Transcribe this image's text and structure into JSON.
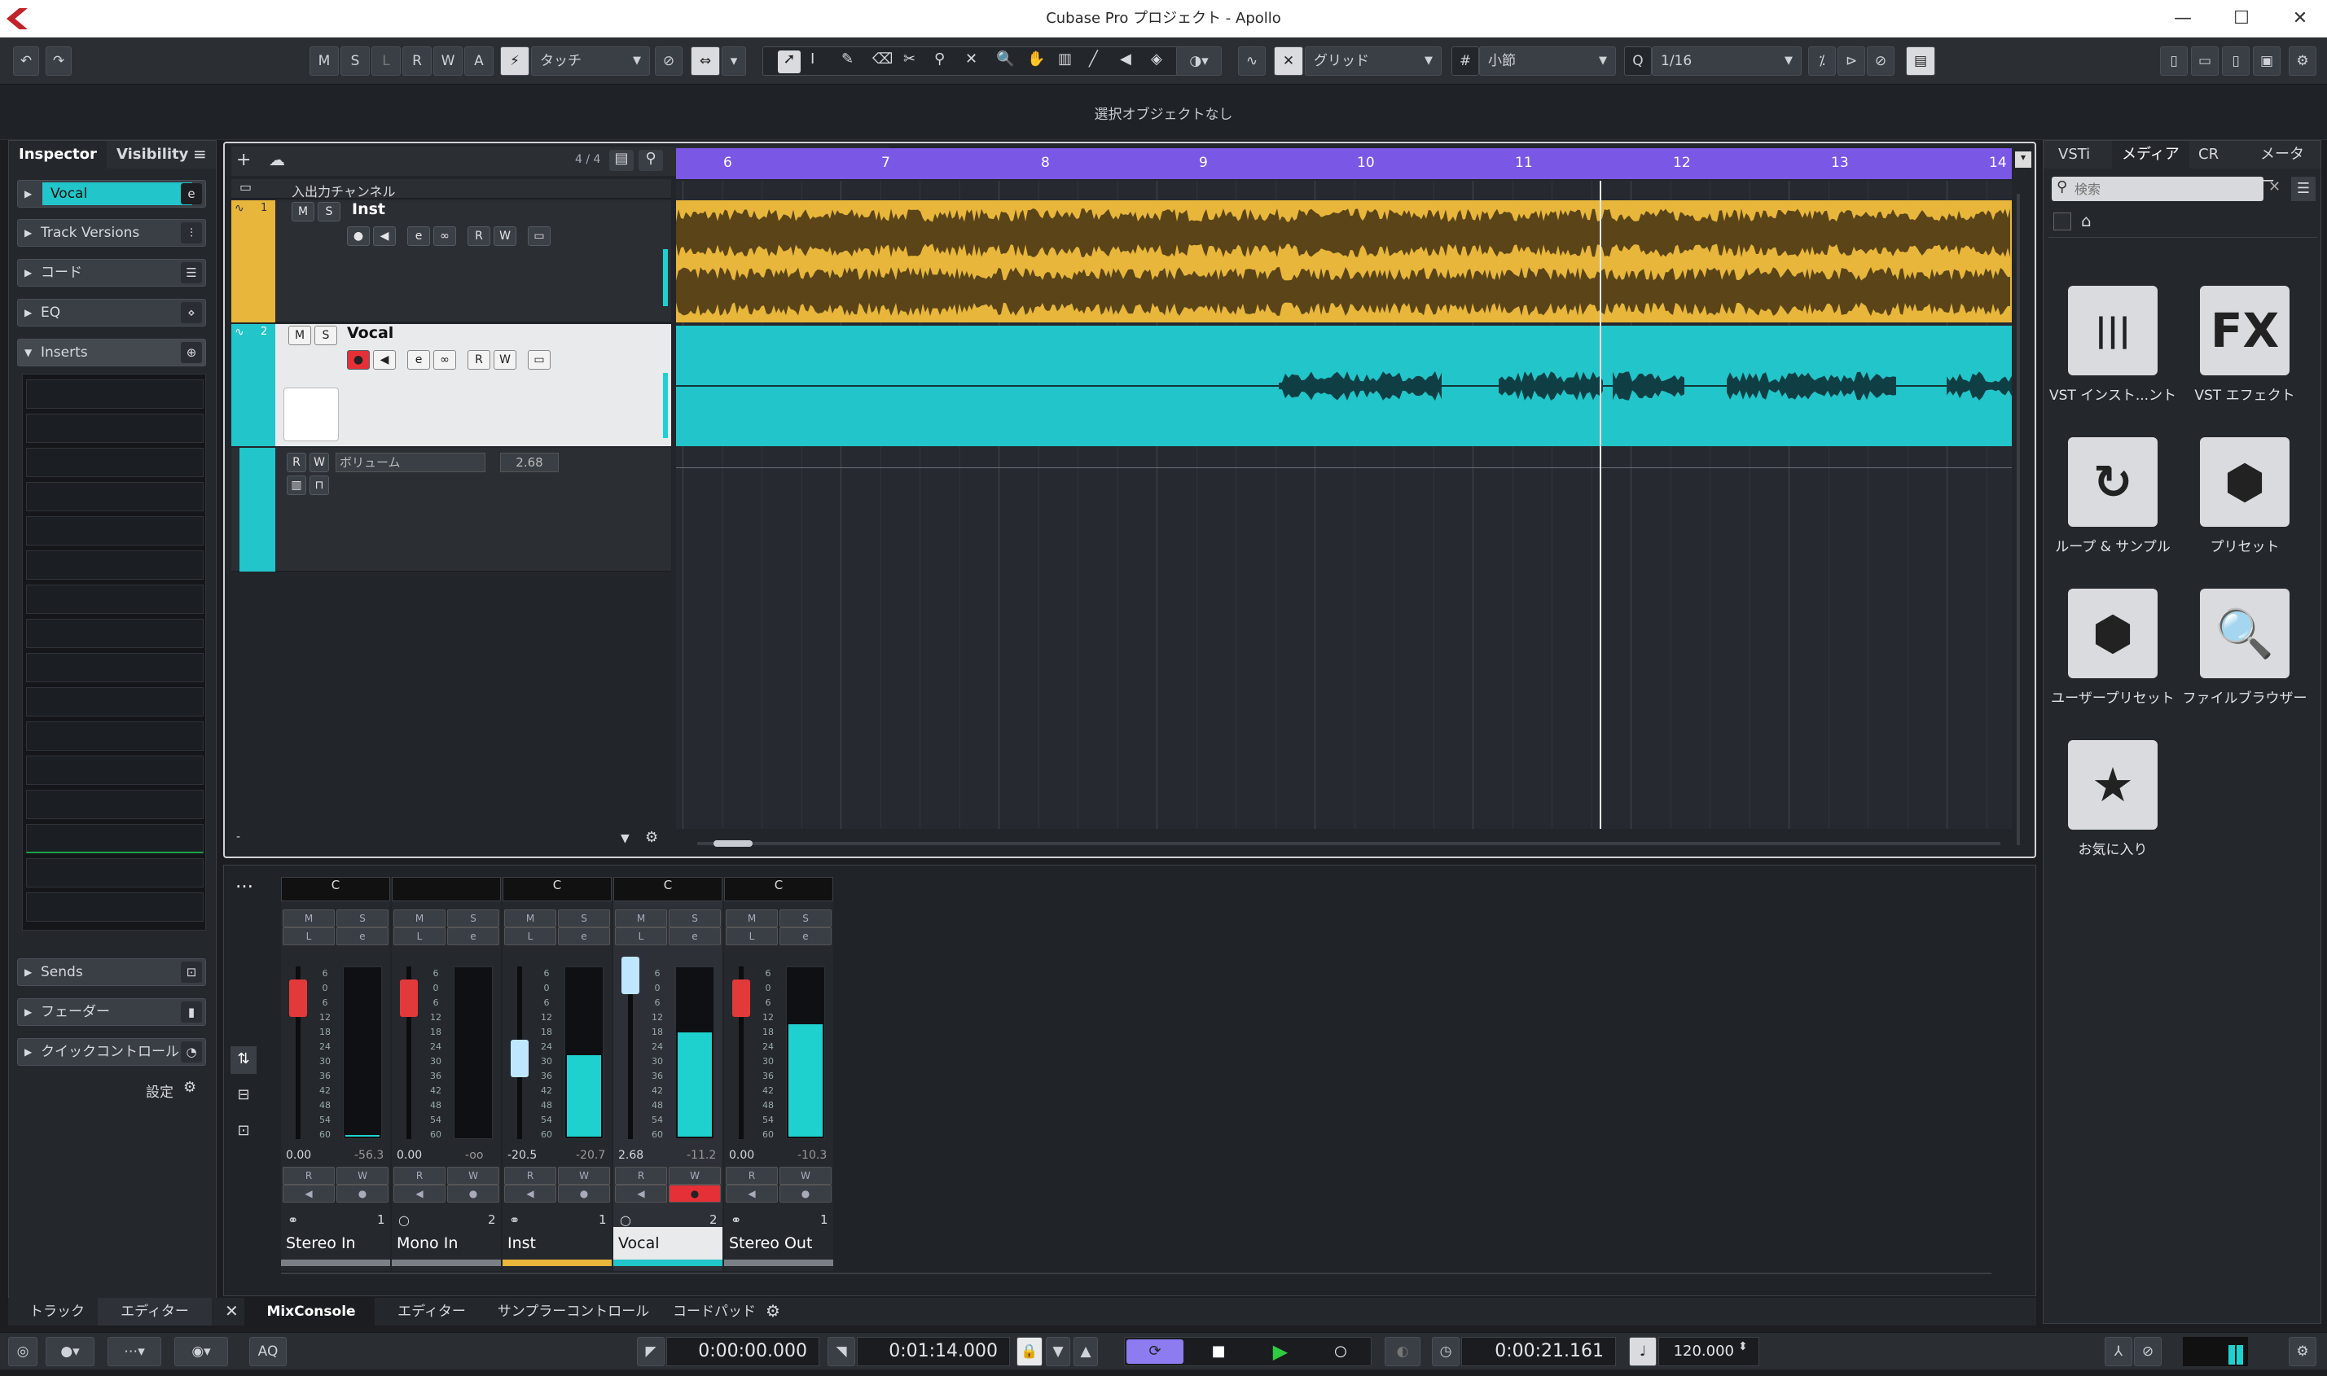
{
  "window": {
    "title": "Cubase Pro プロジェクト - Apollo"
  },
  "toolbar": {
    "msl": [
      "M",
      "S",
      "L",
      "R",
      "W",
      "A"
    ],
    "automation_mode": "タッチ",
    "snap_type": "グリッド",
    "grid_type": "小節",
    "quantize": "1/16"
  },
  "info_line": {
    "text": "選択オブジェクトなし"
  },
  "inspector": {
    "tab_inspector": "Inspector",
    "tab_visibility": "Visibility",
    "track_name": "Vocal",
    "sections": [
      "Track Versions",
      "コード",
      "EQ",
      "Inserts"
    ],
    "lower_sections": [
      "Sends",
      "フェーダー",
      "クイックコントロール"
    ],
    "settings_label": "設定"
  },
  "tracklist": {
    "count": "4 / 4",
    "io_channel": "入出力チャンネル",
    "tracks": [
      {
        "number": "1",
        "name": "Inst"
      },
      {
        "number": "2",
        "name": "Vocal"
      }
    ],
    "volume_label": "ボリューム",
    "volume_value": "2.68"
  },
  "ruler": {
    "bars": [
      "6",
      "7",
      "8",
      "9",
      "10",
      "11",
      "12",
      "13",
      "14"
    ]
  },
  "mixer": {
    "strips": [
      {
        "name": "Stereo In",
        "num": "1",
        "pan": "C",
        "fader": "0.00",
        "peak": "-56.3",
        "color": "#7b7f86"
      },
      {
        "name": "Mono In",
        "num": "2",
        "pan": "",
        "fader": "0.00",
        "peak": "-oo",
        "color": "#7b7f86"
      },
      {
        "name": "Inst",
        "num": "1",
        "pan": "C",
        "fader": "-20.5",
        "peak": "-20.7",
        "color": "#e8b63a"
      },
      {
        "name": "Vocal",
        "num": "2",
        "pan": "C",
        "fader": "2.68",
        "peak": "-11.2",
        "color": "#22c5c9"
      },
      {
        "name": "Stereo Out",
        "num": "1",
        "pan": "C",
        "fader": "0.00",
        "peak": "-10.3",
        "color": "#7b7f86"
      }
    ],
    "scale": [
      "6",
      "0",
      "6",
      "12",
      "18",
      "24",
      "30",
      "36",
      "42",
      "48",
      "54",
      "60"
    ]
  },
  "lower_tabs": {
    "left": [
      "トラック",
      "エディター"
    ],
    "right": [
      "MixConsole",
      "エディター",
      "サンプラーコントロール",
      "コードパッド"
    ]
  },
  "media": {
    "tabs": [
      "VSTi",
      "メディア",
      "CR",
      "メーター"
    ],
    "search_placeholder": "検索",
    "tiles": [
      {
        "label": "VST インスト...ント",
        "icon": "piano-keys-icon",
        "glyph": "|||"
      },
      {
        "label": "VST エフェクト",
        "icon": "fx-icon",
        "glyph": "FX"
      },
      {
        "label": "ループ & サンプル",
        "icon": "loop-icon",
        "glyph": "↻"
      },
      {
        "label": "プリセット",
        "icon": "preset-icon",
        "glyph": "⬢"
      },
      {
        "label": "ユーザープリセット",
        "icon": "user-preset-icon",
        "glyph": "⬢"
      },
      {
        "label": "ファイルブラウザー",
        "icon": "file-browser-icon",
        "glyph": "🔍"
      },
      {
        "label": "お気に入り",
        "icon": "star-icon",
        "glyph": "★"
      }
    ]
  },
  "transport": {
    "left_locator": "0:00:00.000",
    "right_locator": "0:01:14.000",
    "position": "0:00:21.161",
    "tempo": "120.000",
    "aq": "AQ"
  }
}
